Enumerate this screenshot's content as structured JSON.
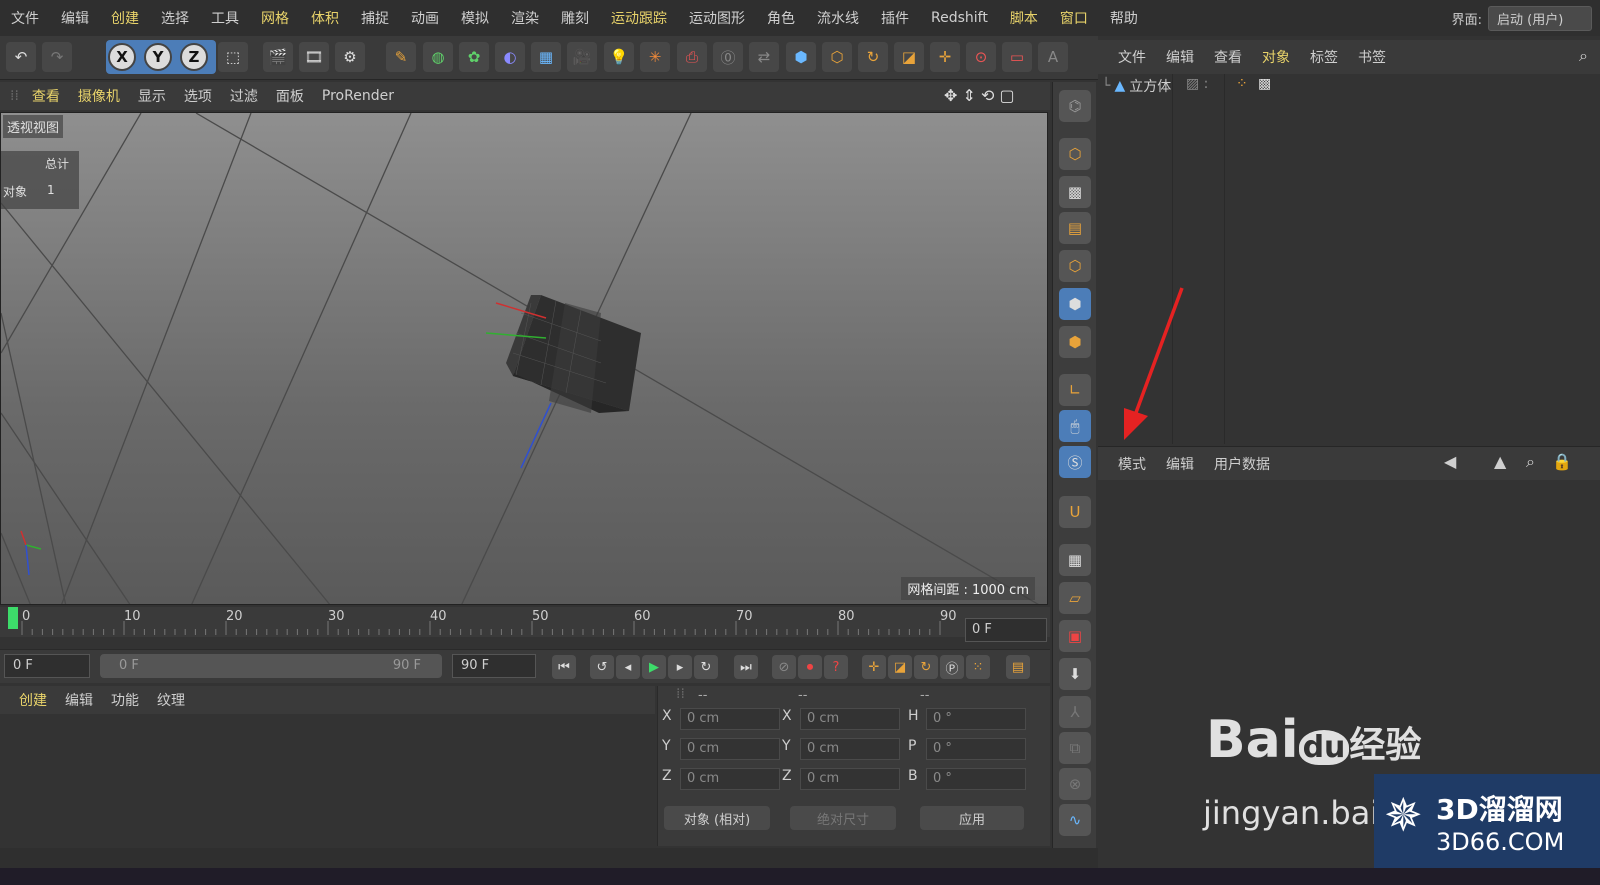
{
  "menu": [
    "文件",
    "编辑",
    "创建",
    "选择",
    "工具",
    "网格",
    "体积",
    "捕捉",
    "动画",
    "模拟",
    "渲染",
    "雕刻",
    "运动跟踪",
    "运动图形",
    "角色",
    "流水线",
    "插件",
    "Redshift",
    "脚本",
    "窗口",
    "帮助"
  ],
  "menu_highlight": [
    2,
    5,
    6,
    12,
    18,
    19
  ],
  "interface_label": "界面:",
  "interface_value": "启动 (用户)",
  "axis_buttons": [
    "X",
    "Y",
    "Z"
  ],
  "viewport_menu": [
    "查看",
    "摄像机",
    "显示",
    "选项",
    "过滤",
    "面板",
    "ProRender"
  ],
  "viewport_label": "透视视图",
  "stats": {
    "header": "总计",
    "row_label": "对象",
    "row_value": "1"
  },
  "grid_spacing": "网格间距 : 1000 cm",
  "timeline_ticks": [
    "0",
    "10",
    "20",
    "30",
    "40",
    "50",
    "60",
    "70",
    "80",
    "90"
  ],
  "current_frame": "0 F",
  "transport": {
    "start": "0 F",
    "range_start": "0 F",
    "range_end": "90 F",
    "end": "90 F"
  },
  "material_menu": [
    "创建",
    "编辑",
    "功能",
    "纹理"
  ],
  "coords": {
    "header": [
      "--",
      "--",
      "--"
    ],
    "rows": [
      [
        "X",
        "0 cm",
        "X",
        "0 cm",
        "H",
        "0 °"
      ],
      [
        "Y",
        "0 cm",
        "Y",
        "0 cm",
        "P",
        "0 °"
      ],
      [
        "Z",
        "0 cm",
        "Z",
        "0 cm",
        "B",
        "0 °"
      ]
    ],
    "mode": "对象 (相对)",
    "size": "绝对尺寸",
    "apply": "应用"
  },
  "objects_menu": [
    "文件",
    "编辑",
    "查看",
    "对象",
    "标签",
    "书签"
  ],
  "objects_highlight": [
    3
  ],
  "object_item": "立方体",
  "attr_menu": [
    "模式",
    "编辑",
    "用户数据"
  ],
  "watermark": {
    "brand": "Bai",
    "du": "du",
    "jingyan": "经验",
    "url": "jingyan.baidu.com",
    "site": "3D溜溜网",
    "site_url": "3D66.COM"
  },
  "colors": {
    "accent": "#e8d36a",
    "arrow": "#e52222"
  }
}
